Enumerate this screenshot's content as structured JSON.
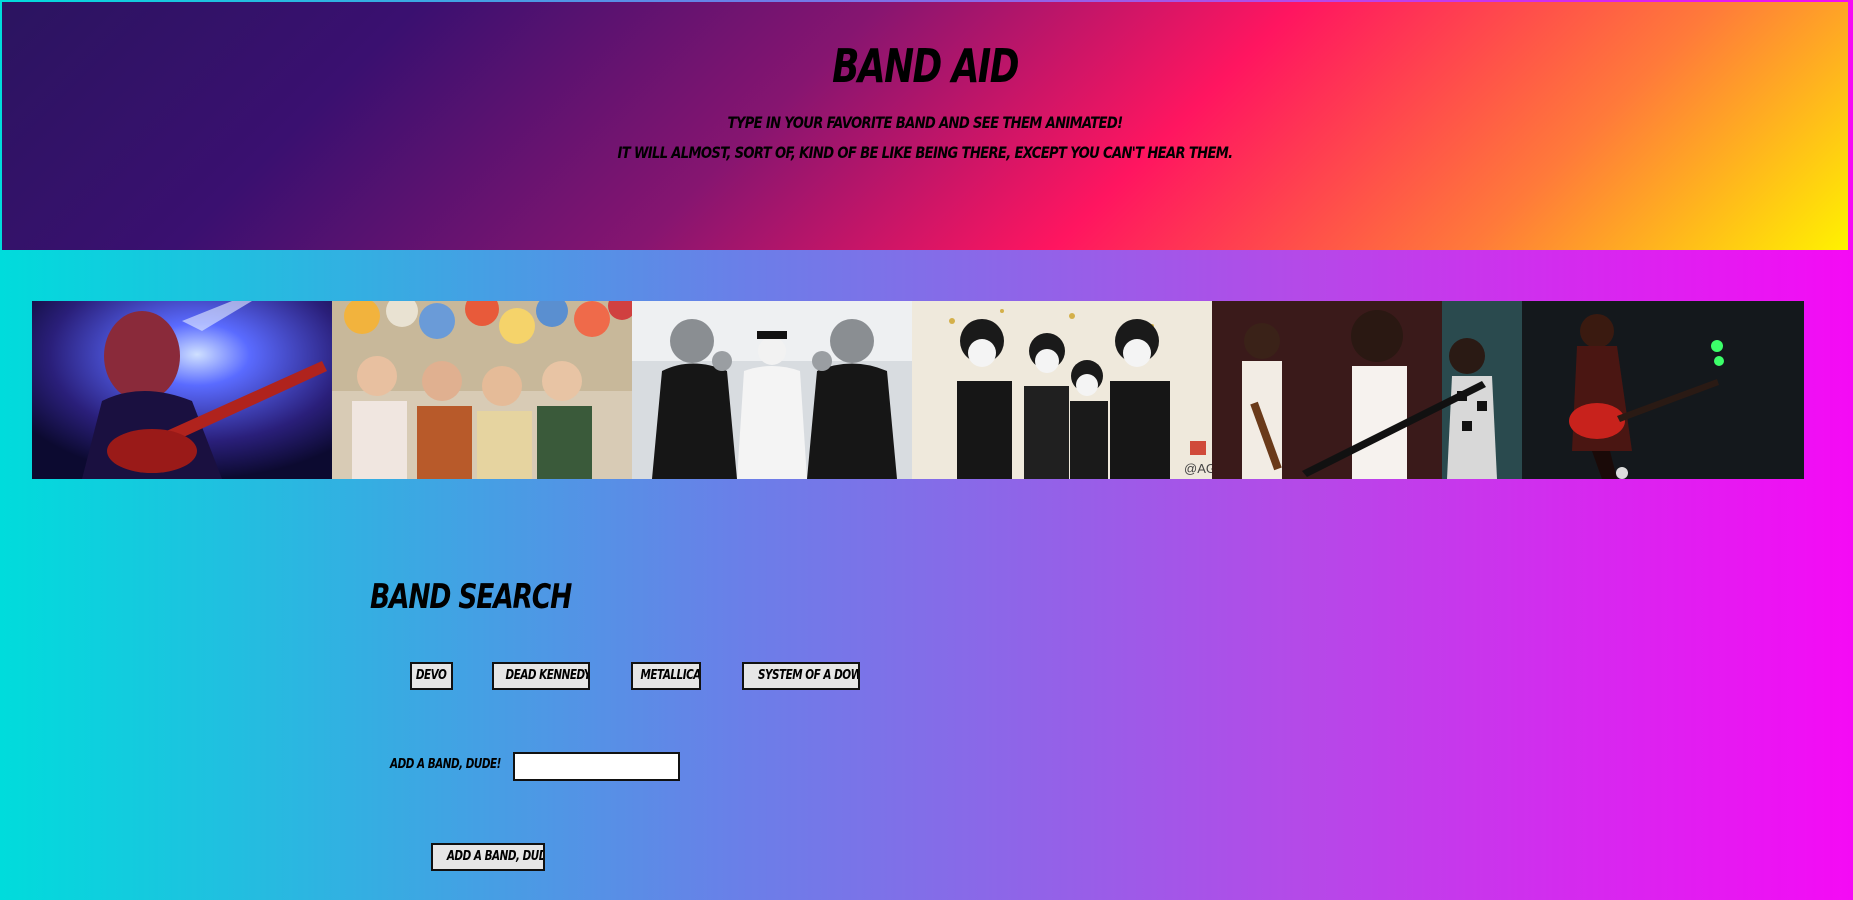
{
  "header": {
    "title": "Band Aid",
    "tagline_line1": "Type in your favorite band and see them animated!",
    "tagline_line2": "It will almost, sort of, kind of be like being there, except you can't hear them.",
    "gradient_colors": [
      "#2b1460",
      "#861570",
      "#ff1560",
      "#ff7a3a",
      "#fff200"
    ]
  },
  "page": {
    "background_colors": [
      "#00dcdc",
      "#6a7fe8",
      "#b44ae8",
      "#f50af5"
    ]
  },
  "gallery": {
    "photos": [
      {
        "name": "guitarist-blue-light-photo"
      },
      {
        "name": "band-with-balloons-photo"
      },
      {
        "name": "masked-band-photo"
      },
      {
        "name": "face-painted-band-photo"
      },
      {
        "name": "rock-band-stage-photo"
      },
      {
        "name": "guitarist-red-guitar-photo"
      }
    ],
    "watermark": "@AG"
  },
  "search": {
    "title": "Band Search",
    "buttons": [
      "Devo",
      "Dead Kennedys",
      "Metallica",
      "System of a Down"
    ],
    "input_label": "Add a band, dude!",
    "input_value": "",
    "input_placeholder": "",
    "submit_label": "Add a band, dude!"
  }
}
